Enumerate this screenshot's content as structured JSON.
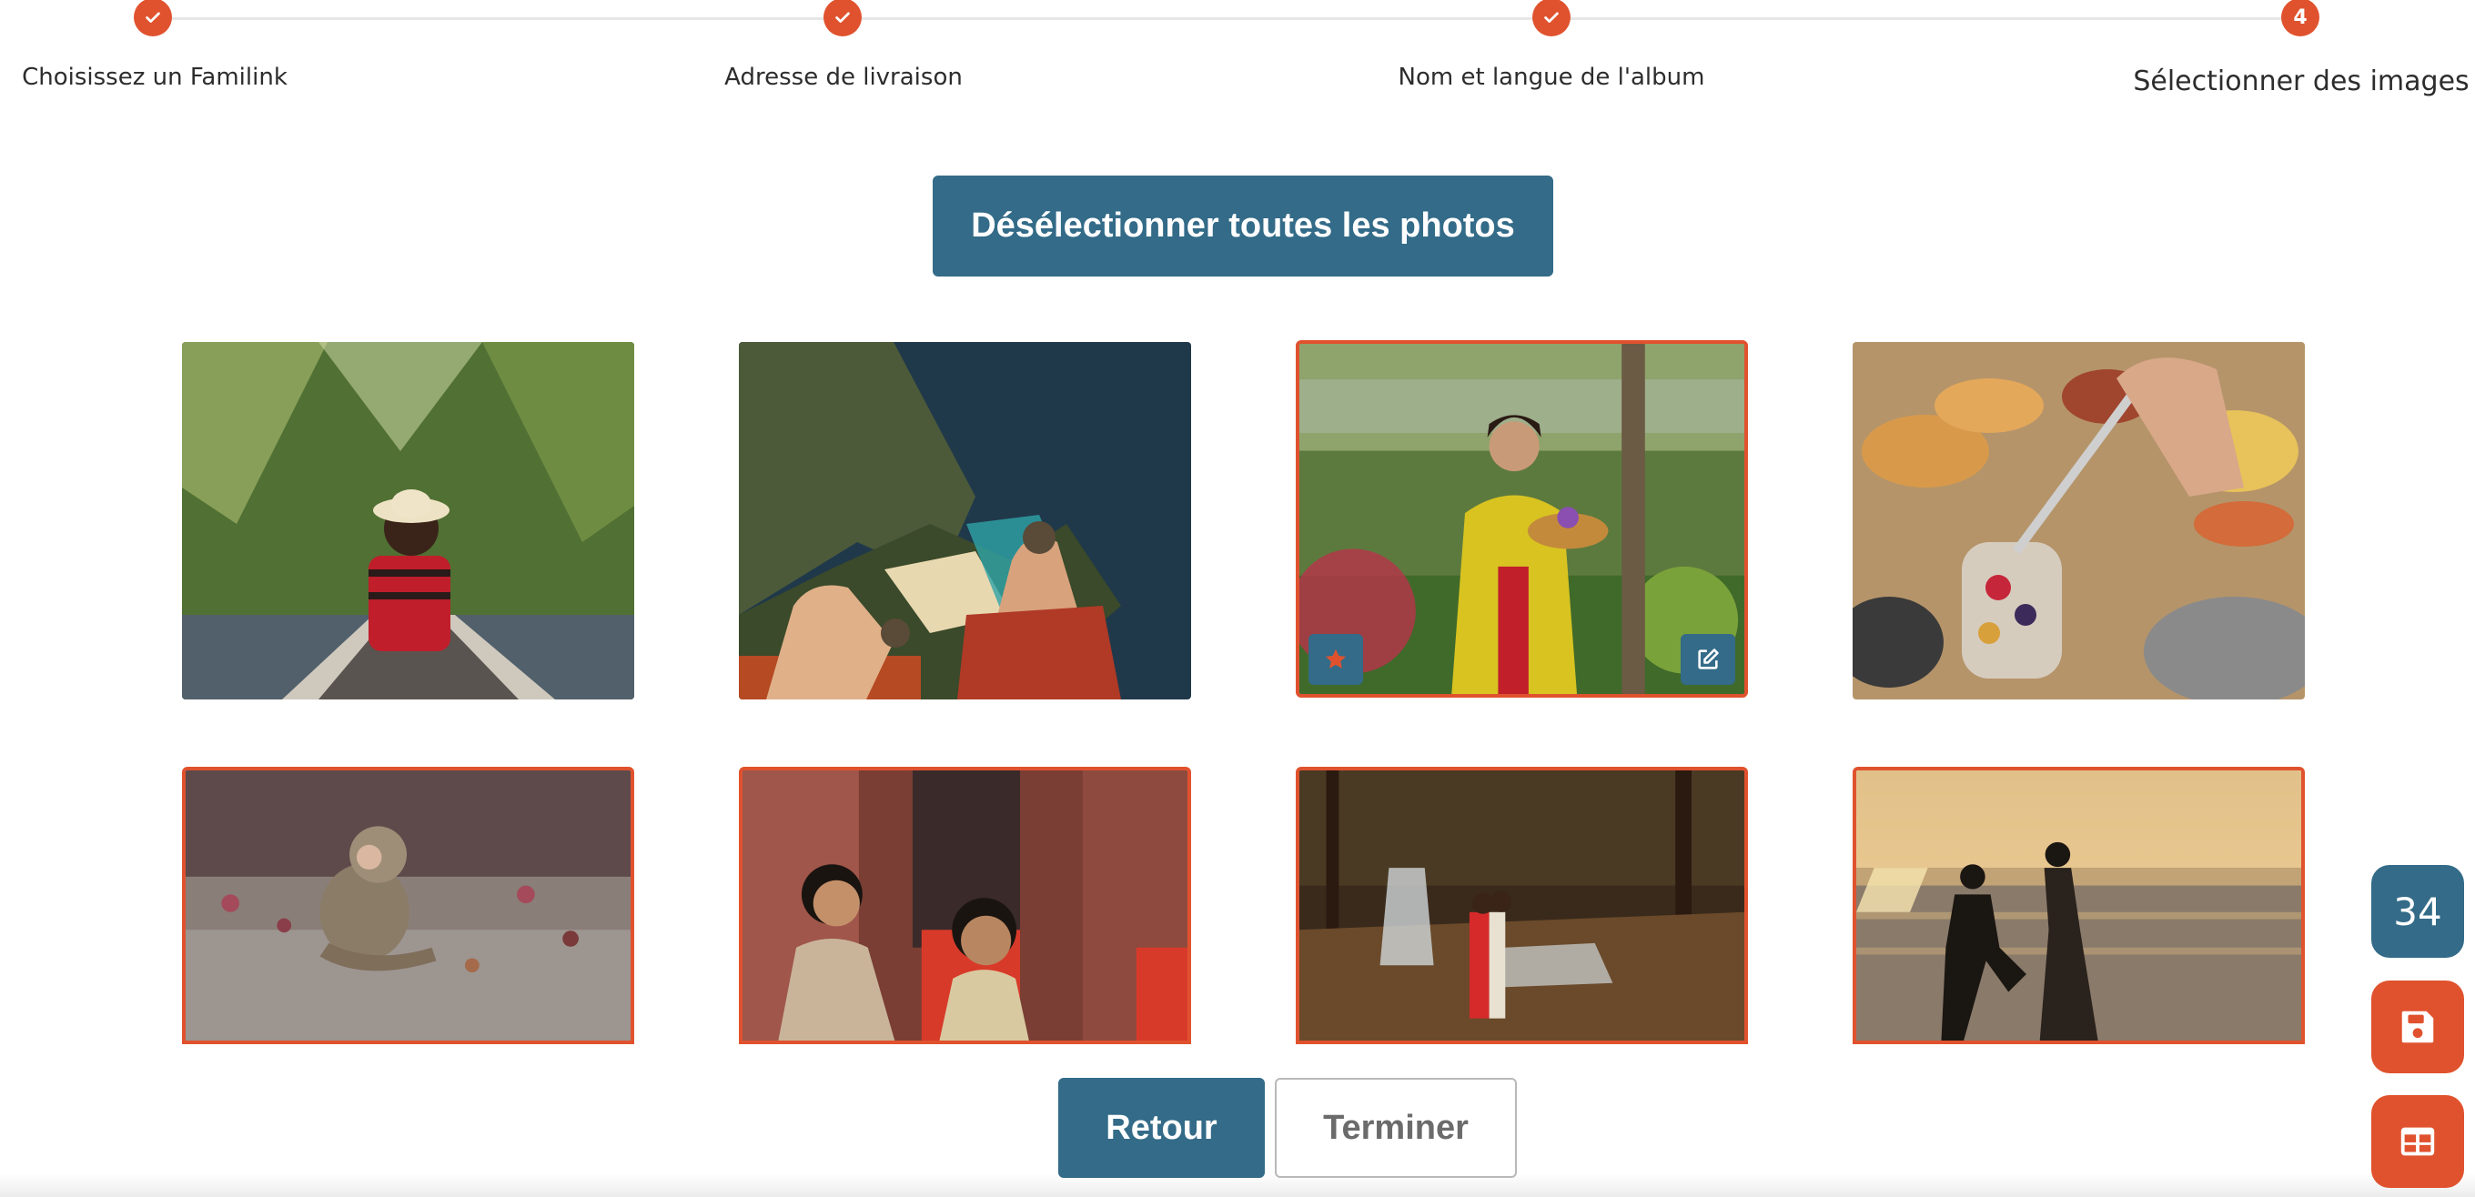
{
  "stepper": {
    "steps": [
      {
        "label": "Choisissez un Familink",
        "state": "done"
      },
      {
        "label": "Adresse de livraison",
        "state": "done"
      },
      {
        "label": "Nom et langue de l'album",
        "state": "done"
      },
      {
        "label": "Sélectionner des images",
        "state": "current",
        "number": "4"
      }
    ]
  },
  "deselect_button": "Désélectionner toutes les photos",
  "photos": [
    {
      "subject": "woman in hat on boat in palm tunnel",
      "selected": false
    },
    {
      "subject": "feet dangling over cliff and beach",
      "selected": false
    },
    {
      "subject": "woman in yellow kebaya with offering",
      "selected": true,
      "actions": [
        "star-icon",
        "edit-icon"
      ]
    },
    {
      "subject": "breakfast with fruit jar and spoon",
      "selected": false
    },
    {
      "subject": "monkey sitting on stone pavement",
      "selected": true
    },
    {
      "subject": "two women at temple gate",
      "selected": true
    },
    {
      "subject": "couple at waterfall in forest",
      "selected": true
    },
    {
      "subject": "proposal at sunset on beach",
      "selected": true
    }
  ],
  "navigation": {
    "back_label": "Retour",
    "finish_label": "Terminer"
  },
  "floating": {
    "count": "34",
    "save_icon": "floppy-disk-icon",
    "layout_icon": "layout-grid-icon"
  },
  "colors": {
    "accent": "#e0522e",
    "primary": "#336b88"
  }
}
